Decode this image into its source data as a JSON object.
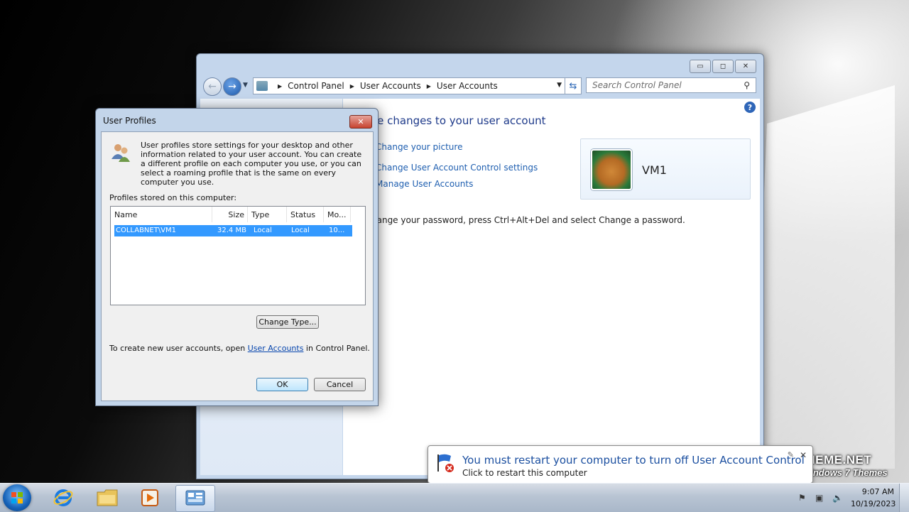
{
  "control_panel": {
    "breadcrumb": [
      "Control Panel",
      "User Accounts",
      "User Accounts"
    ],
    "search_placeholder": "Search Control Panel",
    "heading": "ke changes to your user account",
    "links": [
      "Change your picture",
      "Change User Account Control settings",
      "Manage User Accounts"
    ],
    "note": "hange your password, press Ctrl+Alt+Del and select Change a password.",
    "account_name": "VM1",
    "caption_buttons": {
      "minimize": "▭",
      "maximize": "◻",
      "close": "✕"
    }
  },
  "user_profiles_dialog": {
    "title": "User Profiles",
    "description": "User profiles store settings for your desktop and other information related to your user account. You can create a different profile on each computer you use, or you can select a roaming profile that is the same on every computer you use.",
    "stored_label": "Profiles stored on this computer:",
    "columns": [
      "Name",
      "Size",
      "Type",
      "Status",
      "Mo..."
    ],
    "rows": [
      {
        "name": "COLLABNET\\VM1",
        "size": "32.4 MB",
        "type": "Local",
        "status": "Local",
        "modified": "10..."
      }
    ],
    "change_type_button": "Change Type...",
    "create_text_prefix": "To create new user accounts, open ",
    "create_text_link": "User Accounts",
    "create_text_suffix": " in Control Panel.",
    "ok_button": "OK",
    "cancel_button": "Cancel"
  },
  "notification": {
    "title": "You must restart your computer to turn off User Account Control",
    "subtitle": "Click to restart this computer"
  },
  "watermark": {
    "title": "W7THEME.NET",
    "subtitle": "The best Windows 7 Themes"
  },
  "taskbar": {
    "apps": [
      "internet-explorer-icon",
      "windows-explorer-icon",
      "media-player-icon",
      "control-panel-icon"
    ],
    "clock_time": "9:07 AM",
    "clock_date": "10/19/2023"
  }
}
